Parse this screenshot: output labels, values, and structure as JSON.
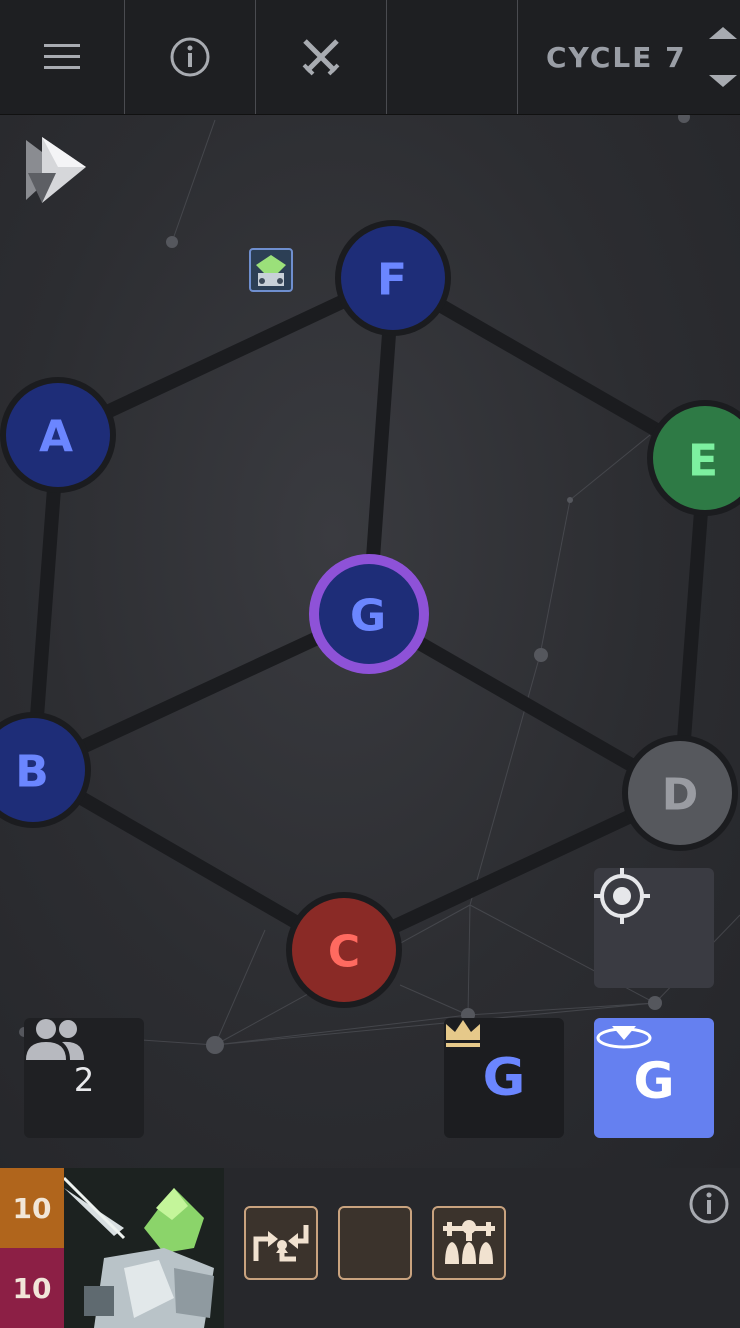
{
  "topbar": {
    "menu_icon": "hamburger-menu-icon",
    "info_icon": "info-icon",
    "battle_icon": "crossed-swords-icon",
    "cycle_label": "CYCLE 7"
  },
  "map": {
    "nodes": [
      {
        "id": "A",
        "label": "A",
        "color": "#1e2d78",
        "text_color": "#6b86ff"
      },
      {
        "id": "B",
        "label": "B",
        "color": "#1e2d78",
        "text_color": "#6b86ff"
      },
      {
        "id": "C",
        "label": "C",
        "color": "#8a2a26",
        "text_color": "#ff6a60"
      },
      {
        "id": "D",
        "label": "D",
        "color": "#56585d",
        "text_color": "#9a9ca2"
      },
      {
        "id": "E",
        "label": "E",
        "color": "#2e7a45",
        "text_color": "#7df0a0"
      },
      {
        "id": "F",
        "label": "F",
        "color": "#1e2d78",
        "text_color": "#6b86ff"
      },
      {
        "id": "G",
        "label": "G",
        "color": "#1e2d78",
        "text_color": "#6b86ff",
        "ring": "#8e52d8"
      }
    ]
  },
  "controls": {
    "players_count": "2",
    "players_icon": "people-icon",
    "leader_icon": "crown-icon",
    "leader_label": "G",
    "move_label": "G",
    "move_icon": "move-down-arrow-icon",
    "recenter_icon": "crosshair-icon",
    "play_icon": "play-icon"
  },
  "unit": {
    "stat_top": "10",
    "stat_bottom": "10",
    "stat_top_color": "#b0651c",
    "stat_bottom_color": "#8c1f45",
    "info_icon": "info-icon",
    "abilities": [
      "swap-arrows-icon",
      "empty-slot",
      "formation-icon"
    ]
  },
  "colors": {
    "accent_blue": "#6580f0",
    "topbar": "#1e1f22",
    "ability_border": "#c9a37f"
  }
}
